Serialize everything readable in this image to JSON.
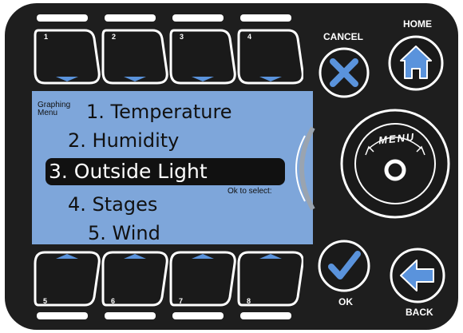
{
  "soft_keys": {
    "top": [
      {
        "label": "1"
      },
      {
        "label": "2"
      },
      {
        "label": "3"
      },
      {
        "label": "4"
      }
    ],
    "bottom": [
      {
        "label": "5"
      },
      {
        "label": "6"
      },
      {
        "label": "7"
      },
      {
        "label": "8"
      }
    ]
  },
  "screen": {
    "header_line1": "Graphing",
    "header_line2": "Menu",
    "items": [
      {
        "label": "1. Temperature"
      },
      {
        "label": "2. Humidity"
      },
      {
        "label": "3. Outside Light"
      },
      {
        "label": "4. Stages"
      },
      {
        "label": "5. Wind"
      }
    ],
    "selected_index": 2,
    "hint": "Ok to select:"
  },
  "buttons": {
    "cancel_label": "CANCEL",
    "home_label": "HOME",
    "menu_label": "MENU",
    "ok_label": "OK",
    "back_label": "BACK"
  },
  "icons": {
    "cancel": "x-icon",
    "home": "home-icon",
    "ok": "checkmark-icon",
    "back": "back-arrow-icon",
    "menu": "dial-icon"
  },
  "colors": {
    "body": "#1e1e1e",
    "screen": "#7ea6da",
    "accent_blue": "#5a93dc",
    "key_fill": "#1a1a1a"
  }
}
